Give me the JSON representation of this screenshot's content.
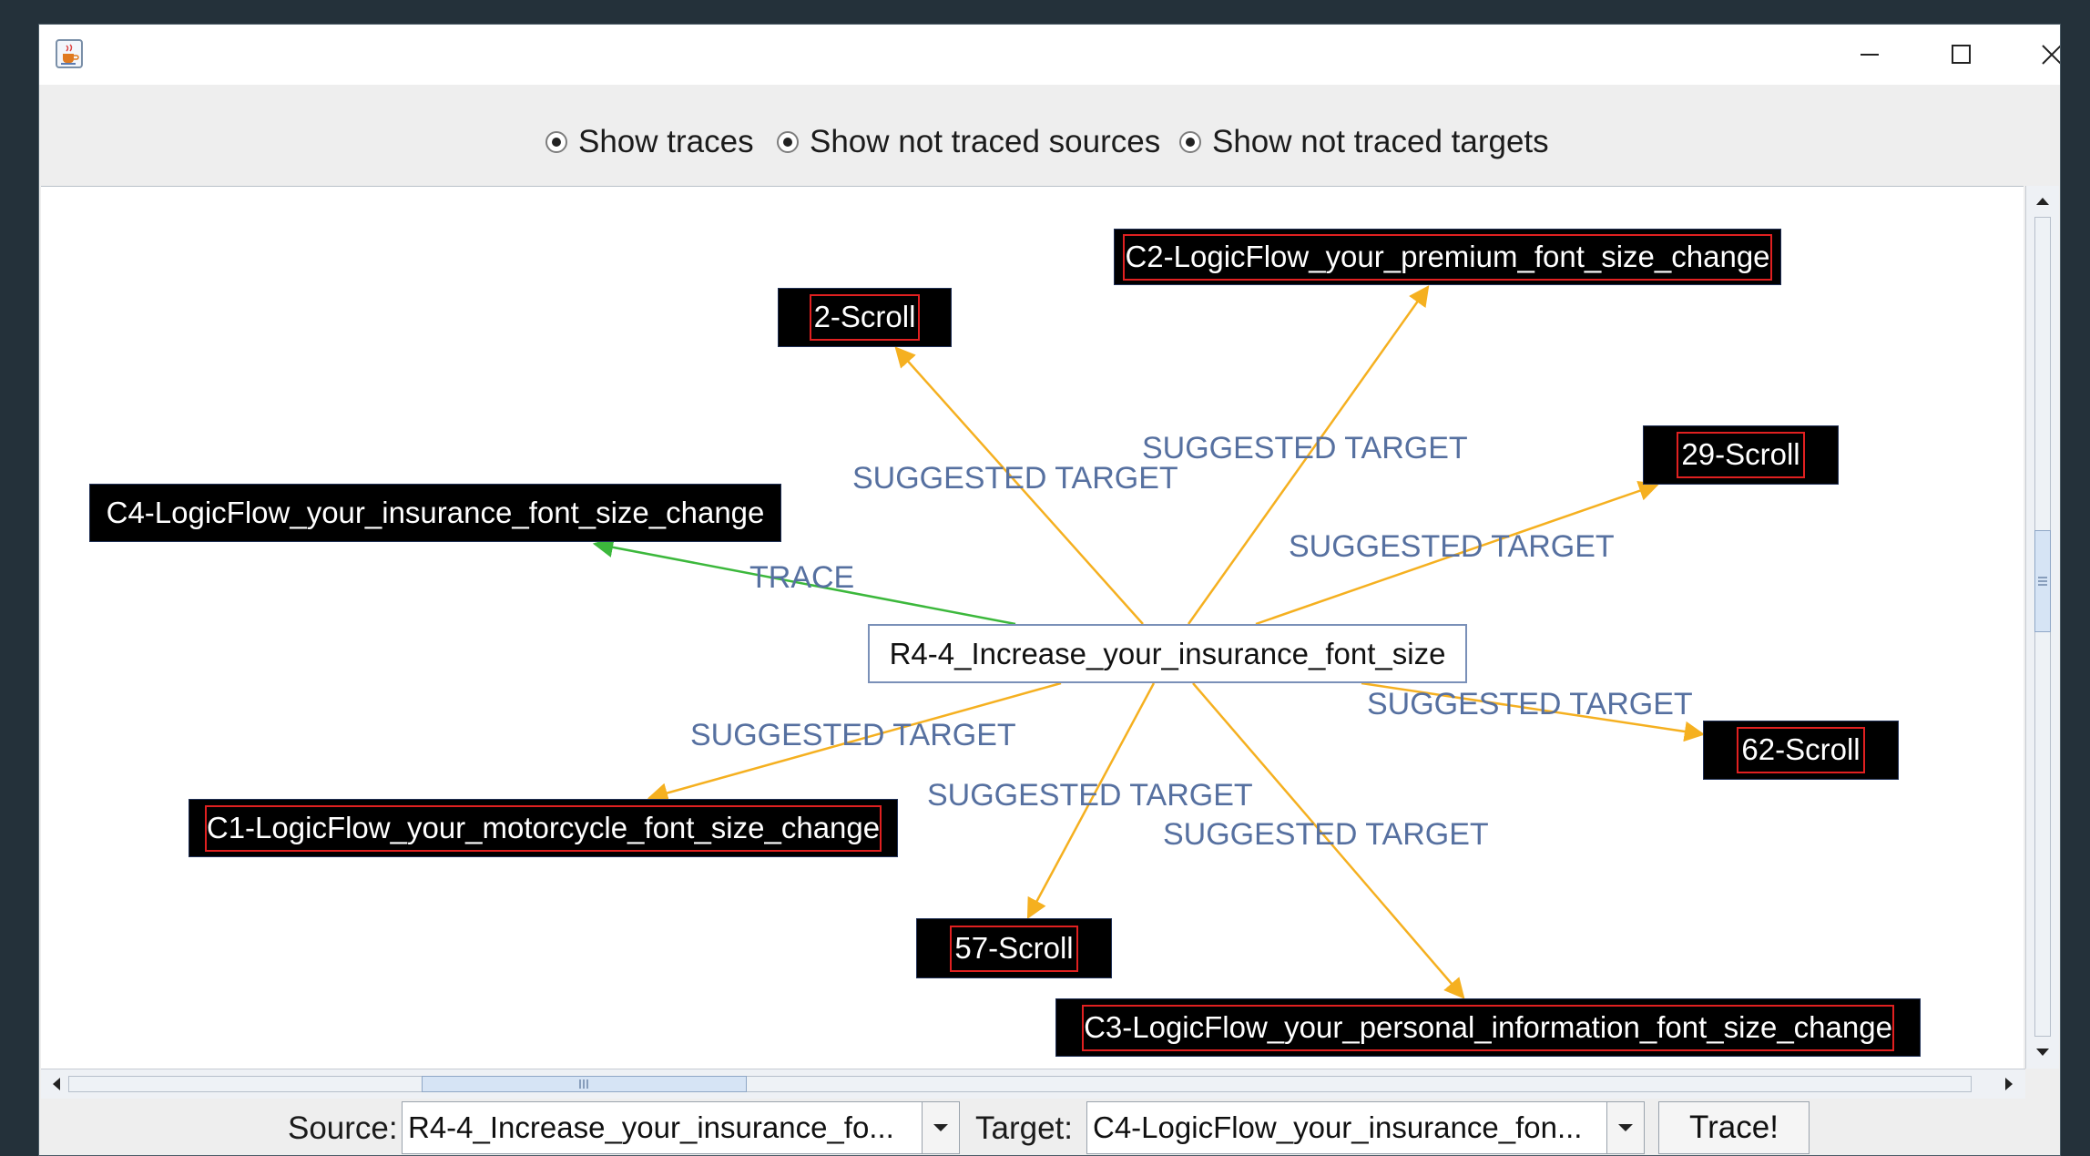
{
  "options": [
    {
      "label": "Show traces",
      "selected": true
    },
    {
      "label": "Show not traced sources",
      "selected": true
    },
    {
      "label": "Show not traced targets",
      "selected": true
    }
  ],
  "graph": {
    "center_node": "R4-4_Increase_your_insurance_font_size",
    "nodes": [
      {
        "id": "n-c2",
        "label": "C2-LogicFlow_your_premium_font_size_change"
      },
      {
        "id": "n-2scroll",
        "label": "2-Scroll"
      },
      {
        "id": "n-29scroll",
        "label": "29-Scroll"
      },
      {
        "id": "n-c4",
        "label": "C4-LogicFlow_your_insurance_font_size_change"
      },
      {
        "id": "n-62scroll",
        "label": "62-Scroll"
      },
      {
        "id": "n-c1",
        "label": "C1-LogicFlow_your_motorcycle_font_size_change"
      },
      {
        "id": "n-57scroll",
        "label": "57-Scroll"
      },
      {
        "id": "n-c3",
        "label": "C3-LogicFlow_your_personal_information_font_size_change"
      }
    ],
    "edge_labels": [
      "SUGGESTED TARGET",
      "SUGGESTED TARGET",
      "SUGGESTED TARGET",
      "TRACE",
      "SUGGESTED TARGET",
      "SUGGESTED TARGET",
      "SUGGESTED TARGET",
      "SUGGESTED TARGET"
    ],
    "colors": {
      "suggested_edge": "#f5b020",
      "trace_edge": "#3cb83c",
      "edge_label": "#5670a0",
      "node_bg": "#000000",
      "node_highlight": "#e02020"
    }
  },
  "bottom": {
    "source_label": "Source:",
    "source_value": "R4-4_Increase_your_insurance_fo...",
    "target_label": "Target:",
    "target_value": "C4-LogicFlow_your_insurance_fon...",
    "trace_button": "Trace!"
  },
  "icons": {
    "app": "java-cup-icon",
    "minimize": "minimize-icon",
    "maximize": "maximize-icon",
    "close": "close-icon"
  }
}
